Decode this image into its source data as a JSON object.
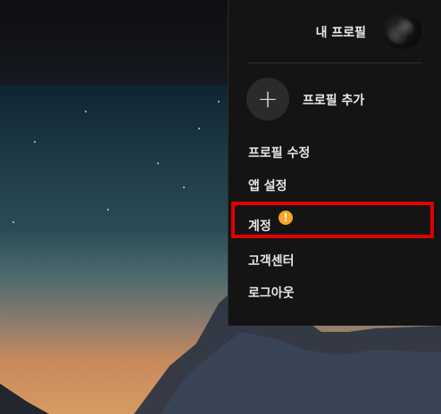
{
  "profile_menu": {
    "current_profile_name": "내 프로필",
    "add_profile_label": "프로필 추가",
    "items": [
      {
        "label": "프로필 수정"
      },
      {
        "label": "앱 설정"
      },
      {
        "label": "계정",
        "status": "warning"
      },
      {
        "label": "고객센터"
      },
      {
        "label": "로그아웃"
      }
    ]
  },
  "colors": {
    "menu_background": "#141414",
    "highlight_border": "#e00000",
    "warning_icon": "#f5a623"
  },
  "icons": {
    "add": "plus-icon",
    "warning": "warning-icon",
    "avatar": "avatar-icon"
  }
}
